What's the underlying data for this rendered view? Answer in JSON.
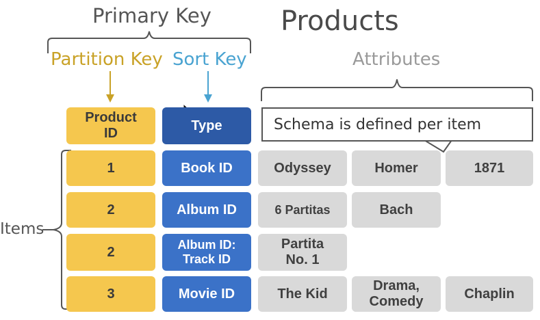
{
  "title": "Products",
  "labels": {
    "primary_key": "Primary Key",
    "partition_key": "Partition Key",
    "sort_key": "Sort Key",
    "attributes": "Attributes",
    "items": "Items"
  },
  "headers": {
    "partition": "Product ID",
    "sort": "Type",
    "schema_note": "Schema is defined per item"
  },
  "rows": [
    {
      "pk": "1",
      "sk": "Book ID",
      "attrs": [
        "Odyssey",
        "Homer",
        "1871"
      ]
    },
    {
      "pk": "2",
      "sk": "Album ID",
      "attrs": [
        "6 Partitas",
        "Bach"
      ]
    },
    {
      "pk": "2",
      "sk": "Album ID: Track ID",
      "attrs": [
        "Partita No. 1"
      ]
    },
    {
      "pk": "3",
      "sk": "Movie ID",
      "attrs": [
        "The Kid",
        "Drama, Comedy",
        "Chaplin"
      ]
    }
  ],
  "colors": {
    "partition_key": "#f5c74e",
    "sort_key": "#3b72c8",
    "attribute": "#d9d9d9",
    "partition_label": "#c9a227",
    "sort_label": "#49a3d1"
  }
}
